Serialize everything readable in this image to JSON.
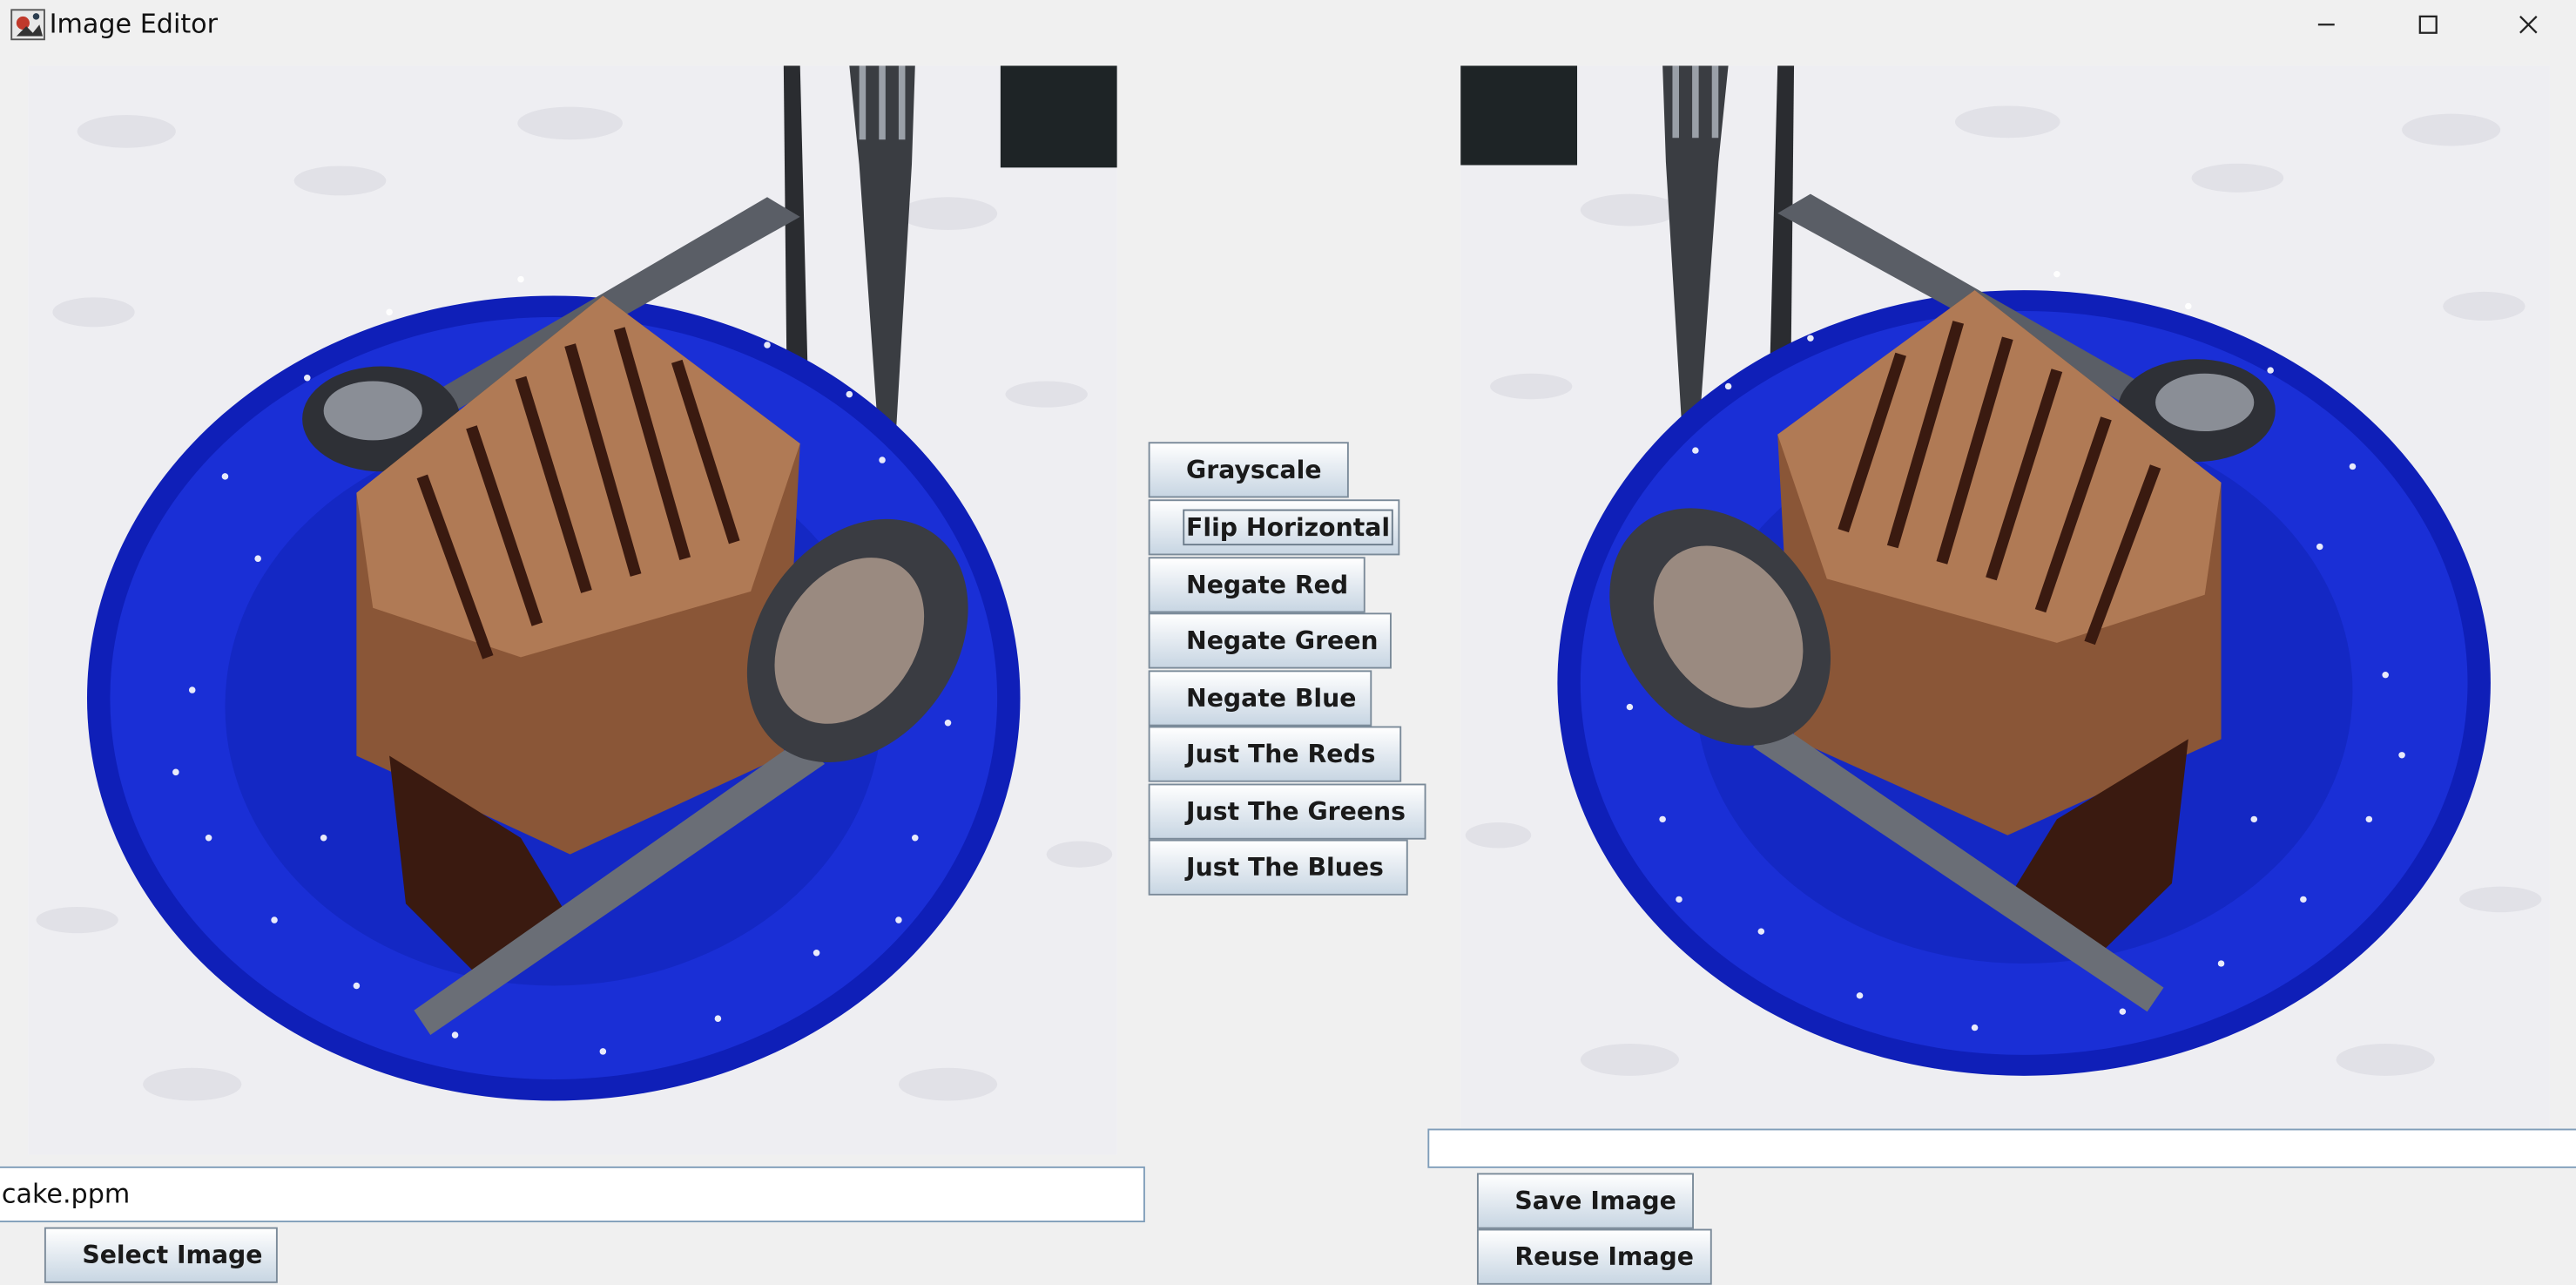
{
  "window": {
    "title": "Image Editor",
    "controls": {
      "minimize": "minimize-icon",
      "maximize": "maximize-icon",
      "close": "close-icon"
    }
  },
  "filters": [
    {
      "label": "Grayscale"
    },
    {
      "label": "Flip Horizontal"
    },
    {
      "label": "Negate Red"
    },
    {
      "label": "Negate Green"
    },
    {
      "label": "Negate Blue"
    },
    {
      "label": "Just The Reds"
    },
    {
      "label": "Just The Greens"
    },
    {
      "label": "Just The Blues"
    }
  ],
  "input": {
    "filename": "cake.ppm",
    "select_label": "Select Image"
  },
  "output": {
    "filename": "",
    "save_label": "Save Image",
    "reuse_label": "Reuse Image"
  },
  "colors": {
    "plate": "#1a2fd6",
    "cake": "#8a5637",
    "frosting": "#b07a55",
    "chocolate": "#3a1a10",
    "tablecloth": "#eeeef2"
  }
}
